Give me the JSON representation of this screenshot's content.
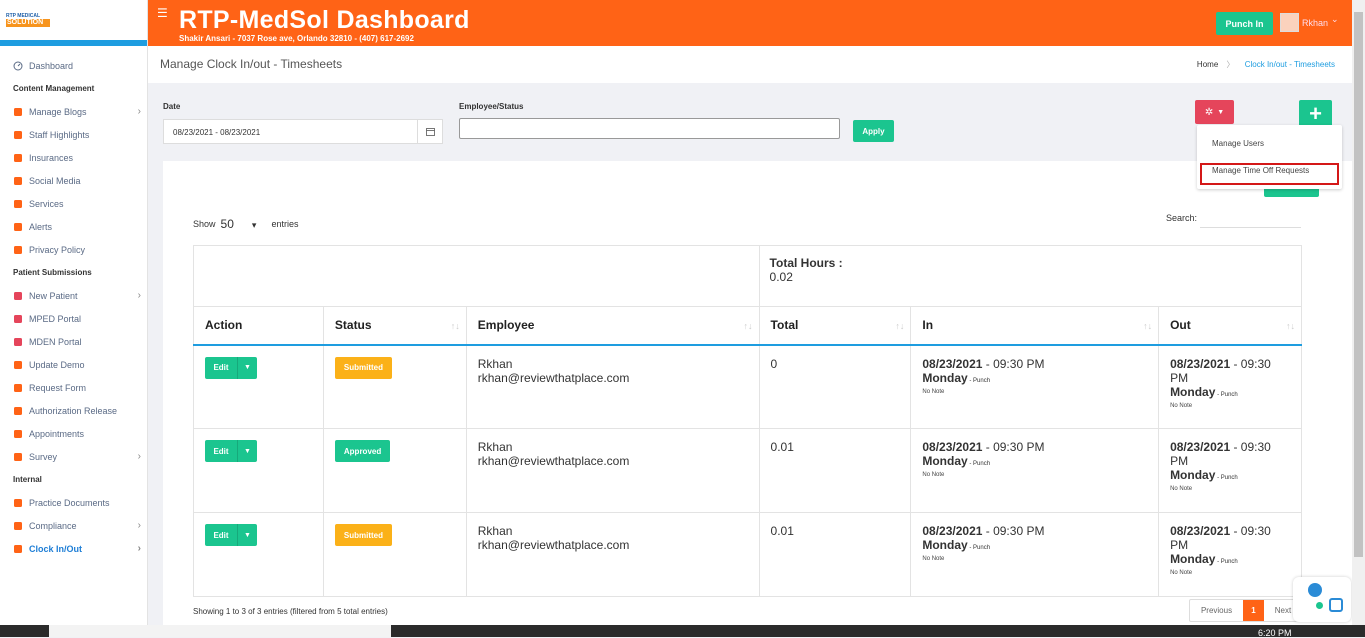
{
  "brand": {
    "logo_top": "RTP MEDICAL",
    "logo_bottom": "SOLUTION"
  },
  "header": {
    "title": "RTP-MedSol Dashboard",
    "subtitle": "Shakir Ansari - 7037 Rose ave, Orlando 32810 - (407) 617-2692",
    "punch_label": "Punch In",
    "user_name": "Rkhan",
    "user_caret": "⌄",
    "menu_icon": "☰"
  },
  "sidebar": {
    "dashboard": "Dashboard",
    "section1": "Content Management",
    "content_items": [
      {
        "label": "Manage Blogs",
        "icon": "rss-icon",
        "color": "#ff6316",
        "chev": true
      },
      {
        "label": "Staff Highlights",
        "icon": "user-icon",
        "color": "#ff6316",
        "chev": false
      },
      {
        "label": "Insurances",
        "icon": "briefcase-icon",
        "color": "#ff6316",
        "chev": false
      },
      {
        "label": "Social Media",
        "icon": "share-icon",
        "color": "#ff6316",
        "chev": false
      },
      {
        "label": "Services",
        "icon": "service-icon",
        "color": "#ff6316",
        "chev": false
      },
      {
        "label": "Alerts",
        "icon": "phone-icon",
        "color": "#ff6316",
        "chev": false
      },
      {
        "label": "Privacy Policy",
        "icon": "shield-icon",
        "color": "#ff6316",
        "chev": false
      }
    ],
    "section2": "Patient Submissions",
    "patient_items": [
      {
        "label": "New Patient",
        "icon": "home-icon",
        "color": "#e5455b",
        "chev": true
      },
      {
        "label": "MPED Portal",
        "icon": "home-icon",
        "color": "#e5455b",
        "chev": false
      },
      {
        "label": "MDEN Portal",
        "icon": "home-icon",
        "color": "#e5455b",
        "chev": false
      },
      {
        "label": "Update Demo",
        "icon": "id-card-icon",
        "color": "#ff6316",
        "chev": false
      },
      {
        "label": "Request Form",
        "icon": "file-icon",
        "color": "#ff6316",
        "chev": false
      },
      {
        "label": "Authorization Release",
        "icon": "check-file-icon",
        "color": "#ff6316",
        "chev": false
      },
      {
        "label": "Appointments",
        "icon": "calendar-icon",
        "color": "#ff6316",
        "chev": false
      },
      {
        "label": "Survey",
        "icon": "chart-icon",
        "color": "#ff6316",
        "chev": true
      }
    ],
    "section3": "Internal",
    "internal_items": [
      {
        "label": "Practice Documents",
        "icon": "clipboard-icon",
        "color": "#ff6316",
        "chev": false
      },
      {
        "label": "Compliance",
        "icon": "signature-icon",
        "color": "#ff6316",
        "chev": true
      },
      {
        "label": "Clock In/Out",
        "icon": "clock-icon",
        "color": "#ff6316",
        "chev": true
      }
    ]
  },
  "page": {
    "title": "Manage Clock In/out - Timesheets",
    "crumb_home": "Home",
    "crumb_sep": "〉",
    "crumb_current": "Clock In/out - Timesheets"
  },
  "filters": {
    "date_label": "Date",
    "date_value": "08/23/2021 - 08/23/2021",
    "emp_label": "Employee/Status",
    "emp_value": "",
    "apply": "Apply"
  },
  "menu": {
    "items": [
      "Manage Users",
      "Manage Time Off Requests"
    ]
  },
  "table_ctrl": {
    "show": "Show",
    "show_value": "50",
    "entries": "entries",
    "search": "Search:"
  },
  "total": {
    "label": "Total Hours :",
    "value": "0.02"
  },
  "columns": [
    "Action",
    "Status",
    "Employee",
    "Total",
    "In",
    "Out"
  ],
  "rows": [
    {
      "edit": "Edit",
      "status": "Submitted",
      "status_color": "#fbb118",
      "name": "Rkhan",
      "email": "rkhan@reviewthatplace.com",
      "total": "0",
      "in_date": "08/23/2021",
      "in_time": " - 09:30 PM",
      "in_day": "Monday",
      "in_punch": " - Punch",
      "in_note": "No Note",
      "out_date": "08/23/2021",
      "out_time": " - 09:30 PM",
      "out_day": "Monday",
      "out_punch": " - Punch",
      "out_note": "No Note"
    },
    {
      "edit": "Edit",
      "status": "Approved",
      "status_color": "#1bc58f",
      "name": "Rkhan",
      "email": "rkhan@reviewthatplace.com",
      "total": "0.01",
      "in_date": "08/23/2021",
      "in_time": " - 09:30 PM",
      "in_day": "Monday",
      "in_punch": " - Punch",
      "in_note": "No Note",
      "out_date": "08/23/2021",
      "out_time": " - 09:30 PM",
      "out_day": "Monday",
      "out_punch": " - Punch",
      "out_note": "No Note"
    },
    {
      "edit": "Edit",
      "status": "Submitted",
      "status_color": "#fbb118",
      "name": "Rkhan",
      "email": "rkhan@reviewthatplace.com",
      "total": "0.01",
      "in_date": "08/23/2021",
      "in_time": " - 09:30 PM",
      "in_day": "Monday",
      "in_punch": " - Punch",
      "in_note": "No Note",
      "out_date": "08/23/2021",
      "out_time": " - 09:30 PM",
      "out_day": "Monday",
      "out_punch": " - Punch",
      "out_note": "No Note"
    }
  ],
  "footer": {
    "showing": "Showing 1 to 3 of 3 entries (filtered from 5 total entries)",
    "prev": "Previous",
    "page": "1",
    "next": "Next"
  },
  "taskbar": {
    "clock": "6:20 PM"
  }
}
